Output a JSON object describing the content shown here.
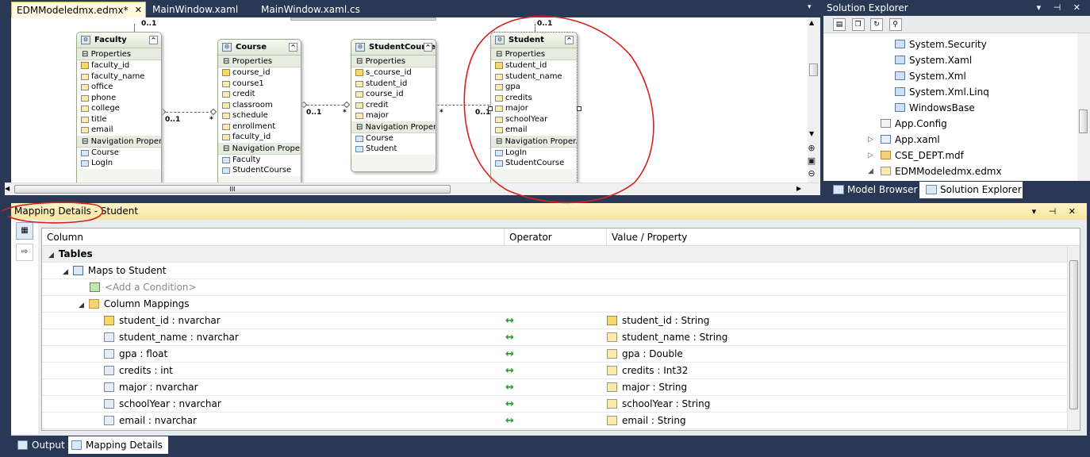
{
  "doc_tabs": {
    "active": "EDMModeledmx.edmx*",
    "tab2": "MainWindow.xaml",
    "tab3": "MainWindow.xaml.cs",
    "close_glyph": "✕",
    "dropdown_glyph": "▾"
  },
  "entities": {
    "faculty": {
      "name": "Faculty",
      "properties_label": "Properties",
      "properties": [
        "faculty_id",
        "faculty_name",
        "office",
        "phone",
        "college",
        "title",
        "email"
      ],
      "nav_label": "Navigation Proper...",
      "nav": [
        "Course",
        "LogIn"
      ]
    },
    "course": {
      "name": "Course",
      "properties_label": "Properties",
      "properties": [
        "course_id",
        "course1",
        "credit",
        "classroom",
        "schedule",
        "enrollment",
        "faculty_id"
      ],
      "nav_label": "Navigation Proper...",
      "nav": [
        "Faculty",
        "StudentCourse"
      ]
    },
    "studentcourse": {
      "name": "StudentCourse",
      "properties_label": "Properties",
      "properties": [
        "s_course_id",
        "student_id",
        "course_id",
        "credit",
        "major"
      ],
      "nav_label": "Navigation Proper...",
      "nav": [
        "Course",
        "Student"
      ]
    },
    "student": {
      "name": "Student",
      "properties_label": "Properties",
      "properties": [
        "student_id",
        "student_name",
        "gpa",
        "credits",
        "major",
        "schoolYear",
        "email"
      ],
      "nav_label": "Navigation Proper...",
      "nav": [
        "LogIn",
        "StudentCourse"
      ]
    }
  },
  "multiplicity": {
    "top1": "0..1",
    "top2": "0..1",
    "a1": "0..1",
    "a2": "*",
    "b1": "0..1",
    "b2": "*",
    "c1": "*",
    "c2": "0..1"
  },
  "designer": {
    "scroll_thumb": "III"
  },
  "solution_explorer": {
    "title": "Solution Explorer",
    "pins": "▾ ⊣ ✕",
    "items": [
      "System.Security",
      "System.Xaml",
      "System.Xml",
      "System.Xml.Linq",
      "WindowsBase",
      "App.Config",
      "App.xaml",
      "CSE_DEPT.mdf",
      "EDMModeledmx.edmx"
    ],
    "tabs": [
      "Model Browser",
      "Solution Explorer"
    ]
  },
  "mapping_details": {
    "title": "Mapping Details - Student",
    "pins": "▾ ⊣ ✕",
    "headers": [
      "Column",
      "Operator",
      "Value / Property"
    ],
    "tables_label": "Tables",
    "maps_to": "Maps to Student",
    "add_condition": "<Add a Condition>",
    "column_mappings": "Column Mappings",
    "operator": "↔",
    "rows": [
      {
        "column": "student_id : nvarchar",
        "value": "student_id : String"
      },
      {
        "column": "student_name : nvarchar",
        "value": "student_name : String"
      },
      {
        "column": "gpa : float",
        "value": "gpa : Double"
      },
      {
        "column": "credits : int",
        "value": "credits : Int32"
      },
      {
        "column": "major : nvarchar",
        "value": "major : String"
      },
      {
        "column": "schoolYear : nvarchar",
        "value": "schoolYear : String"
      },
      {
        "column": "email : nvarchar",
        "value": "email : String"
      }
    ]
  },
  "bottom_tabs": [
    "Output",
    "Mapping Details"
  ],
  "colors": {
    "chrome": "#293955",
    "annotation": "#d42020",
    "arrow": "#2a9a2a"
  }
}
